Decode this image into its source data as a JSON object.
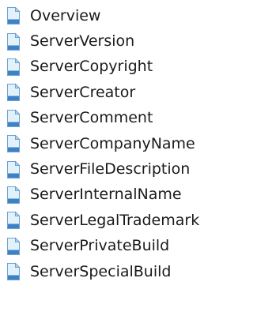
{
  "topics": {
    "icon": "document-page-icon",
    "icon_colors": {
      "fill": "#e3f1fb",
      "stroke": "#6fa3cd",
      "band": "#3d82c4",
      "fold": "#b8d6ee"
    },
    "items": [
      {
        "label": "Overview"
      },
      {
        "label": "ServerVersion"
      },
      {
        "label": "ServerCopyright"
      },
      {
        "label": "ServerCreator"
      },
      {
        "label": "ServerComment"
      },
      {
        "label": "ServerCompanyName"
      },
      {
        "label": "ServerFileDescription"
      },
      {
        "label": "ServerInternalName"
      },
      {
        "label": "ServerLegalTrademark"
      },
      {
        "label": "ServerPrivateBuild"
      },
      {
        "label": "ServerSpecialBuild"
      }
    ]
  }
}
